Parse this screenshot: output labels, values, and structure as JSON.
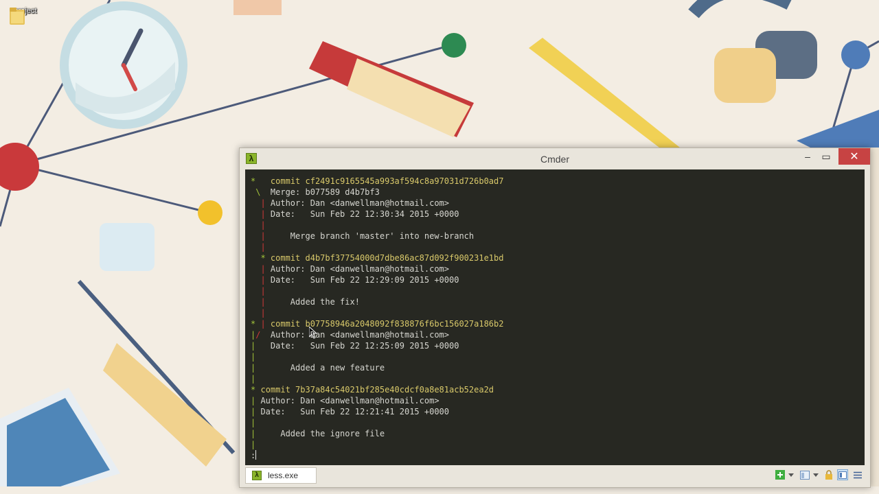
{
  "desktop": {
    "icons": [
      {
        "label": "project",
        "icon": "folder-icon"
      }
    ]
  },
  "window": {
    "title": "Cmder",
    "app_icon": "lambda-icon",
    "app_icon_glyph": "λ",
    "controls": {
      "minimize": "–",
      "maximize": "▭",
      "close": "✕"
    }
  },
  "terminal": {
    "colors": {
      "background": "#272822",
      "graph": "#a3c43a",
      "merge_line": "#d0383a",
      "hash": "#d9c96a",
      "text": "#d6d6d0"
    },
    "lines": [
      [
        [
          "g",
          "*"
        ],
        [
          "w",
          "   "
        ],
        [
          "y",
          "commit cf2491c9165545a993af594c8a97031d726b0ad7"
        ]
      ],
      [
        [
          "g",
          " \\"
        ],
        [
          "w",
          "  Merge: b077589 d4b7bf3"
        ]
      ],
      [
        [
          "r",
          "  |"
        ],
        [
          "w",
          " Author: Dan <danwellman@hotmail.com>"
        ]
      ],
      [
        [
          "r",
          "  |"
        ],
        [
          "w",
          " Date:   Sun Feb 22 12:30:34 2015 +0000"
        ]
      ],
      [
        [
          "r",
          "  |"
        ]
      ],
      [
        [
          "r",
          "  |"
        ],
        [
          "w",
          "     Merge branch 'master' into new-branch"
        ]
      ],
      [
        [
          "r",
          "  |"
        ]
      ],
      [
        [
          "r",
          "  "
        ],
        [
          "g",
          "*"
        ],
        [
          "w",
          " "
        ],
        [
          "y",
          "commit d4b7bf37754000d7dbe86ac87d092f900231e1bd"
        ]
      ],
      [
        [
          "r",
          "  |"
        ],
        [
          "w",
          " Author: Dan <danwellman@hotmail.com>"
        ]
      ],
      [
        [
          "r",
          "  |"
        ],
        [
          "w",
          " Date:   Sun Feb 22 12:29:09 2015 +0000"
        ]
      ],
      [
        [
          "r",
          "  |"
        ]
      ],
      [
        [
          "r",
          "  |"
        ],
        [
          "w",
          "     Added the fix!"
        ]
      ],
      [
        [
          "r",
          "  |"
        ]
      ],
      [
        [
          "g",
          "*"
        ],
        [
          "r",
          " |"
        ],
        [
          "w",
          " "
        ],
        [
          "y",
          "commit b07758946a2048092f838876f6bc156027a186b2"
        ]
      ],
      [
        [
          "g",
          "|"
        ],
        [
          "r",
          "/"
        ],
        [
          "w",
          "  Author: Dan <danwellman@hotmail.com>"
        ]
      ],
      [
        [
          "g",
          "|"
        ],
        [
          "w",
          "   Date:   Sun Feb 22 12:25:09 2015 +0000"
        ]
      ],
      [
        [
          "g",
          "|"
        ]
      ],
      [
        [
          "g",
          "|"
        ],
        [
          "w",
          "       Added a new feature"
        ]
      ],
      [
        [
          "g",
          "|"
        ]
      ],
      [
        [
          "g",
          "*"
        ],
        [
          "w",
          " "
        ],
        [
          "y",
          "commit 7b37a84c54021bf285e40cdcf0a8e81acb52ea2d"
        ]
      ],
      [
        [
          "g",
          "|"
        ],
        [
          "w",
          " Author: Dan <danwellman@hotmail.com>"
        ]
      ],
      [
        [
          "g",
          "|"
        ],
        [
          "w",
          " Date:   Sun Feb 22 12:21:41 2015 +0000"
        ]
      ],
      [
        [
          "g",
          "|"
        ]
      ],
      [
        [
          "g",
          "|"
        ],
        [
          "w",
          "     Added the ignore file"
        ]
      ],
      [
        [
          "g",
          "|"
        ]
      ],
      [
        [
          "w",
          ":"
        ]
      ]
    ]
  },
  "statusbar": {
    "tab_label": "less.exe",
    "tab_icon": "lambda-icon",
    "tab_icon_glyph": "λ",
    "icons": [
      "add-console-icon",
      "dropdown-arrow-icon",
      "console-view-icon",
      "dropdown-arrow-icon",
      "lock-icon",
      "split-view-icon",
      "menu-icon"
    ]
  }
}
